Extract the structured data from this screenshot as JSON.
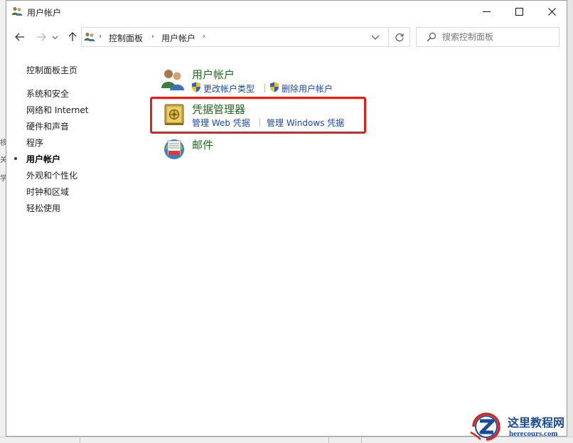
{
  "background": {
    "left_fragments": [
      "核",
      "关",
      "学"
    ]
  },
  "window": {
    "title": "用户帐户",
    "icon": "user-accounts-icon"
  },
  "nav": {
    "back_icon": "arrow-left-icon",
    "forward_icon": "arrow-right-icon",
    "recent_icon": "chevron-down-icon",
    "up_icon": "arrow-up-icon",
    "breadcrumb": [
      "控制面板",
      "用户帐户"
    ],
    "refresh_icon": "refresh-icon",
    "search_placeholder": "搜索控制面板"
  },
  "sidebar": {
    "items": [
      {
        "label": "控制面板主页",
        "active": false
      },
      {
        "label": "系统和安全",
        "active": false
      },
      {
        "label": "网络和 Internet",
        "active": false
      },
      {
        "label": "硬件和声音",
        "active": false
      },
      {
        "label": "程序",
        "active": false
      },
      {
        "label": "用户帐户",
        "active": true
      },
      {
        "label": "外观和个性化",
        "active": false
      },
      {
        "label": "时钟和区域",
        "active": false
      },
      {
        "label": "轻松使用",
        "active": false
      }
    ]
  },
  "main": {
    "categories": [
      {
        "title": "用户帐户",
        "icon": "user-accounts-icon",
        "links": [
          "更改帐户类型",
          "删除用户帐户"
        ],
        "links_have_shield": true
      },
      {
        "title": "凭据管理器",
        "icon": "credential-vault-icon",
        "links": [
          "管理 Web 凭据",
          "管理 Windows 凭据"
        ],
        "links_have_shield": false,
        "highlighted": true
      },
      {
        "title": "邮件",
        "icon": "mail-icon",
        "links": []
      }
    ]
  },
  "watermark": {
    "name": "这里教程网",
    "url": "herecours.com"
  },
  "colors": {
    "category_title": "#1d6b1d",
    "link": "#1a47a8",
    "highlight": "#e1201c"
  }
}
